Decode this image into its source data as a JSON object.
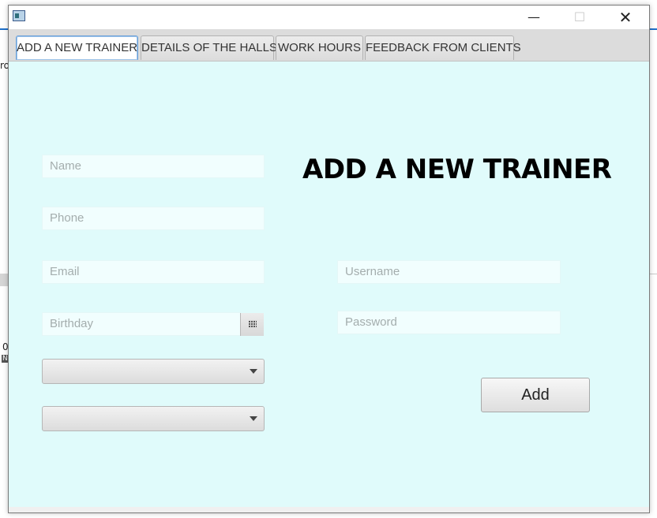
{
  "background": {
    "fragments": [
      "ro",
      "0",
      "N"
    ]
  },
  "window": {
    "controls": {
      "minimize_icon": "minimize-icon",
      "maximize_icon": "maximize-icon",
      "close_icon": "close-icon",
      "minimize_glyph": "—",
      "maximize_glyph": "☐",
      "close_glyph": "✕"
    }
  },
  "tabs": [
    {
      "label": "ADD A NEW TRAINER",
      "active": true
    },
    {
      "label": "DETAILS OF THE HALLS",
      "active": false
    },
    {
      "label": "WORK HOURS",
      "active": false
    },
    {
      "label": "FEEDBACK FROM CLIENTS",
      "active": false
    }
  ],
  "form": {
    "heading": "ADD A NEW TRAINER",
    "name_placeholder": "Name",
    "phone_placeholder": "Phone",
    "email_placeholder": "Email",
    "birthday_placeholder": "Birthday",
    "username_placeholder": "Username",
    "password_placeholder": "Password",
    "combo1_value": "",
    "combo2_value": "",
    "add_label": "Add"
  },
  "colors": {
    "content_bg": "#e0fbfb",
    "field_bg": "#f1fefe",
    "active_tab_border": "#6ba0d8"
  }
}
